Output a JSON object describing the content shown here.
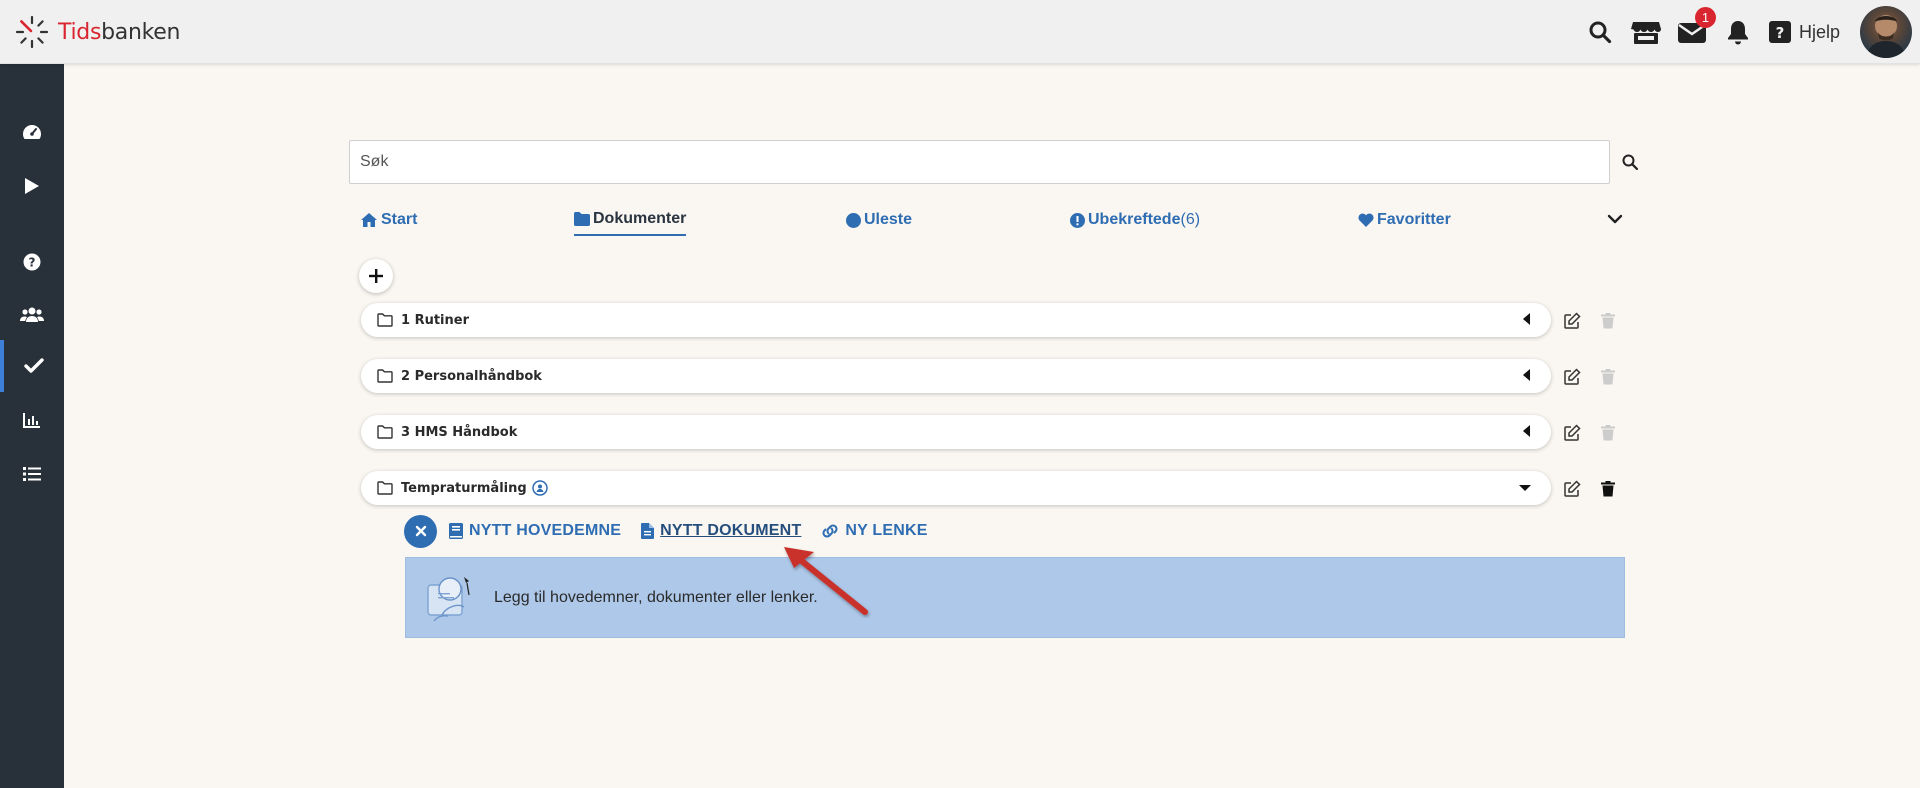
{
  "brand": {
    "part1": "Tids",
    "part2": "banken",
    "accent": "#d9252f"
  },
  "topbar": {
    "icons": [
      "search-icon",
      "store-icon",
      "mail-icon",
      "bell-icon"
    ],
    "mail_badge": "1",
    "help_label": "Hjelp"
  },
  "sidebar": {
    "items": [
      "dashboard-icon",
      "play-icon",
      "help-icon",
      "users-icon",
      "check-icon",
      "chart-icon",
      "list-icon"
    ],
    "active": "check-icon"
  },
  "search": {
    "placeholder": "Søk"
  },
  "tabs": [
    {
      "label": "Start",
      "icon": "home-icon"
    },
    {
      "label": "Dokumenter",
      "icon": "folder-icon",
      "active": true
    },
    {
      "label": "Uleste",
      "icon": "circle-icon"
    },
    {
      "label": "Ubekreftede",
      "count": "(6)",
      "icon": "exclamation-icon"
    },
    {
      "label": "Favoritter",
      "icon": "heart-icon"
    }
  ],
  "folders": [
    {
      "name": "1 Rutiner",
      "expanded": false
    },
    {
      "name": "2 Personalhåndbok",
      "expanded": false
    },
    {
      "name": "3 HMS Håndbok",
      "expanded": false
    },
    {
      "name": "Tempraturmåling",
      "expanded": true
    }
  ],
  "sub_actions": {
    "new_topic": "NYTT HOVEDEMNE",
    "new_document": "NYTT DOKUMENT",
    "new_link": "NY LENKE"
  },
  "info": {
    "text": "Legg til hovedemner, dokumenter eller lenker."
  },
  "colors": {
    "primary": "#2f6db3",
    "sidebar": "#283039",
    "panel": "#aec8e9",
    "annotation_arrow": "#c9302c"
  }
}
